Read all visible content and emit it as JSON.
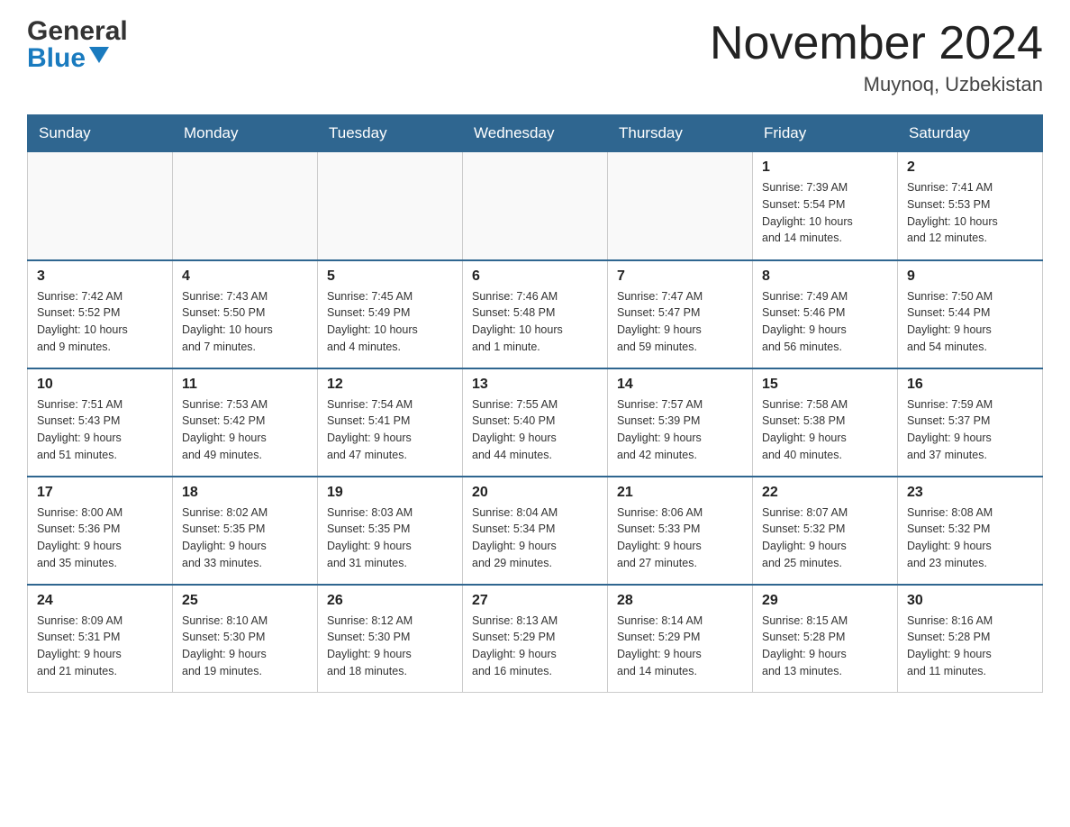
{
  "header": {
    "logo_general": "General",
    "logo_blue": "Blue",
    "month_title": "November 2024",
    "location": "Muynoq, Uzbekistan"
  },
  "days_of_week": [
    "Sunday",
    "Monday",
    "Tuesday",
    "Wednesday",
    "Thursday",
    "Friday",
    "Saturday"
  ],
  "weeks": [
    {
      "days": [
        {
          "num": "",
          "info": ""
        },
        {
          "num": "",
          "info": ""
        },
        {
          "num": "",
          "info": ""
        },
        {
          "num": "",
          "info": ""
        },
        {
          "num": "",
          "info": ""
        },
        {
          "num": "1",
          "info": "Sunrise: 7:39 AM\nSunset: 5:54 PM\nDaylight: 10 hours\nand 14 minutes."
        },
        {
          "num": "2",
          "info": "Sunrise: 7:41 AM\nSunset: 5:53 PM\nDaylight: 10 hours\nand 12 minutes."
        }
      ]
    },
    {
      "days": [
        {
          "num": "3",
          "info": "Sunrise: 7:42 AM\nSunset: 5:52 PM\nDaylight: 10 hours\nand 9 minutes."
        },
        {
          "num": "4",
          "info": "Sunrise: 7:43 AM\nSunset: 5:50 PM\nDaylight: 10 hours\nand 7 minutes."
        },
        {
          "num": "5",
          "info": "Sunrise: 7:45 AM\nSunset: 5:49 PM\nDaylight: 10 hours\nand 4 minutes."
        },
        {
          "num": "6",
          "info": "Sunrise: 7:46 AM\nSunset: 5:48 PM\nDaylight: 10 hours\nand 1 minute."
        },
        {
          "num": "7",
          "info": "Sunrise: 7:47 AM\nSunset: 5:47 PM\nDaylight: 9 hours\nand 59 minutes."
        },
        {
          "num": "8",
          "info": "Sunrise: 7:49 AM\nSunset: 5:46 PM\nDaylight: 9 hours\nand 56 minutes."
        },
        {
          "num": "9",
          "info": "Sunrise: 7:50 AM\nSunset: 5:44 PM\nDaylight: 9 hours\nand 54 minutes."
        }
      ]
    },
    {
      "days": [
        {
          "num": "10",
          "info": "Sunrise: 7:51 AM\nSunset: 5:43 PM\nDaylight: 9 hours\nand 51 minutes."
        },
        {
          "num": "11",
          "info": "Sunrise: 7:53 AM\nSunset: 5:42 PM\nDaylight: 9 hours\nand 49 minutes."
        },
        {
          "num": "12",
          "info": "Sunrise: 7:54 AM\nSunset: 5:41 PM\nDaylight: 9 hours\nand 47 minutes."
        },
        {
          "num": "13",
          "info": "Sunrise: 7:55 AM\nSunset: 5:40 PM\nDaylight: 9 hours\nand 44 minutes."
        },
        {
          "num": "14",
          "info": "Sunrise: 7:57 AM\nSunset: 5:39 PM\nDaylight: 9 hours\nand 42 minutes."
        },
        {
          "num": "15",
          "info": "Sunrise: 7:58 AM\nSunset: 5:38 PM\nDaylight: 9 hours\nand 40 minutes."
        },
        {
          "num": "16",
          "info": "Sunrise: 7:59 AM\nSunset: 5:37 PM\nDaylight: 9 hours\nand 37 minutes."
        }
      ]
    },
    {
      "days": [
        {
          "num": "17",
          "info": "Sunrise: 8:00 AM\nSunset: 5:36 PM\nDaylight: 9 hours\nand 35 minutes."
        },
        {
          "num": "18",
          "info": "Sunrise: 8:02 AM\nSunset: 5:35 PM\nDaylight: 9 hours\nand 33 minutes."
        },
        {
          "num": "19",
          "info": "Sunrise: 8:03 AM\nSunset: 5:35 PM\nDaylight: 9 hours\nand 31 minutes."
        },
        {
          "num": "20",
          "info": "Sunrise: 8:04 AM\nSunset: 5:34 PM\nDaylight: 9 hours\nand 29 minutes."
        },
        {
          "num": "21",
          "info": "Sunrise: 8:06 AM\nSunset: 5:33 PM\nDaylight: 9 hours\nand 27 minutes."
        },
        {
          "num": "22",
          "info": "Sunrise: 8:07 AM\nSunset: 5:32 PM\nDaylight: 9 hours\nand 25 minutes."
        },
        {
          "num": "23",
          "info": "Sunrise: 8:08 AM\nSunset: 5:32 PM\nDaylight: 9 hours\nand 23 minutes."
        }
      ]
    },
    {
      "days": [
        {
          "num": "24",
          "info": "Sunrise: 8:09 AM\nSunset: 5:31 PM\nDaylight: 9 hours\nand 21 minutes."
        },
        {
          "num": "25",
          "info": "Sunrise: 8:10 AM\nSunset: 5:30 PM\nDaylight: 9 hours\nand 19 minutes."
        },
        {
          "num": "26",
          "info": "Sunrise: 8:12 AM\nSunset: 5:30 PM\nDaylight: 9 hours\nand 18 minutes."
        },
        {
          "num": "27",
          "info": "Sunrise: 8:13 AM\nSunset: 5:29 PM\nDaylight: 9 hours\nand 16 minutes."
        },
        {
          "num": "28",
          "info": "Sunrise: 8:14 AM\nSunset: 5:29 PM\nDaylight: 9 hours\nand 14 minutes."
        },
        {
          "num": "29",
          "info": "Sunrise: 8:15 AM\nSunset: 5:28 PM\nDaylight: 9 hours\nand 13 minutes."
        },
        {
          "num": "30",
          "info": "Sunrise: 8:16 AM\nSunset: 5:28 PM\nDaylight: 9 hours\nand 11 minutes."
        }
      ]
    }
  ]
}
